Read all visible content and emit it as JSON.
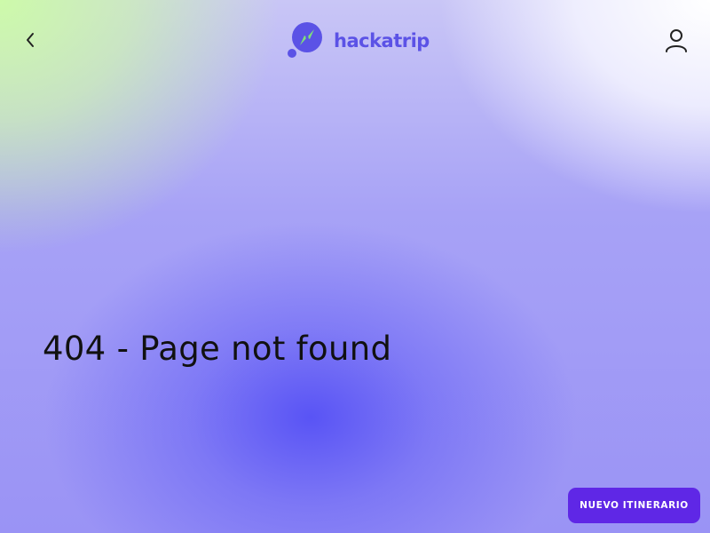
{
  "header": {
    "back_icon": "chevron-left-icon",
    "logo_text": "hackatrip",
    "user_icon": "user-icon",
    "colors": {
      "brand": "#5b52e6",
      "brand_accent": "#7fe07a"
    }
  },
  "main": {
    "title": "404 - Page not found"
  },
  "cta": {
    "label": "NUEVO ITINERARIO",
    "color": "#5f27e6"
  }
}
